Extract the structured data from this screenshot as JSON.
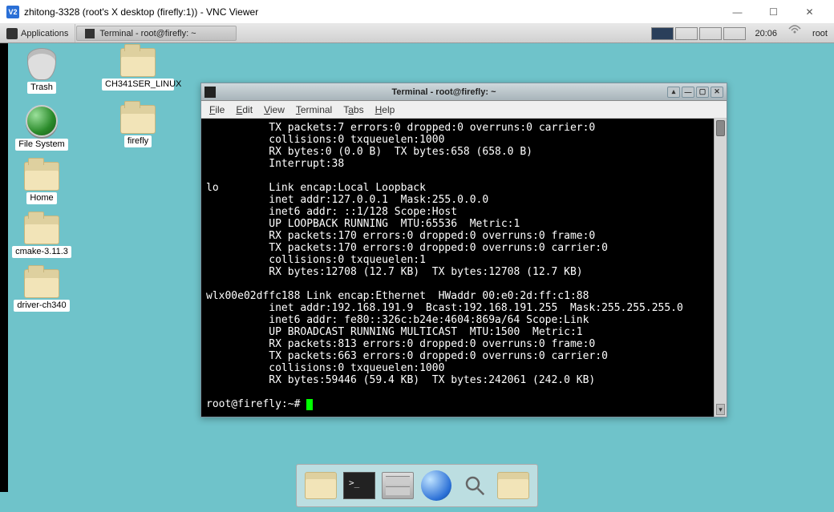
{
  "vnc": {
    "titlebar_icon_label": "V2",
    "title": "zhitong-3328 (root's X desktop (firefly:1)) - VNC Viewer",
    "min_label": "—",
    "max_label": "☐",
    "close_label": "✕"
  },
  "top_panel": {
    "applications": "Applications",
    "task_tab": "Terminal - root@firefly: ~",
    "clock": "20:06",
    "user": "root"
  },
  "desktop_icons": {
    "trash": "Trash",
    "ch341": "CH341SER_LINUX",
    "filesystem": "File System",
    "firefly": "firefly",
    "home": "Home",
    "cmake": "cmake-3.11.3",
    "driver": "driver-ch340"
  },
  "terminal": {
    "title": "Terminal - root@firefly: ~",
    "menus": {
      "file": "File",
      "edit": "Edit",
      "view": "View",
      "terminal": "Terminal",
      "tabs": "Tabs",
      "help": "Help"
    },
    "buttons": {
      "scroll_up": "▴",
      "min": "—",
      "max": "▢",
      "close": "✕"
    },
    "output_lines": [
      "          TX packets:7 errors:0 dropped:0 overruns:0 carrier:0",
      "          collisions:0 txqueuelen:1000",
      "          RX bytes:0 (0.0 B)  TX bytes:658 (658.0 B)",
      "          Interrupt:38",
      "",
      "lo        Link encap:Local Loopback",
      "          inet addr:127.0.0.1  Mask:255.0.0.0",
      "          inet6 addr: ::1/128 Scope:Host",
      "          UP LOOPBACK RUNNING  MTU:65536  Metric:1",
      "          RX packets:170 errors:0 dropped:0 overruns:0 frame:0",
      "          TX packets:170 errors:0 dropped:0 overruns:0 carrier:0",
      "          collisions:0 txqueuelen:1",
      "          RX bytes:12708 (12.7 KB)  TX bytes:12708 (12.7 KB)",
      "",
      "wlx00e02dffc188 Link encap:Ethernet  HWaddr 00:e0:2d:ff:c1:88",
      "          inet addr:192.168.191.9  Bcast:192.168.191.255  Mask:255.255.255.0",
      "          inet6 addr: fe80::326c:b24e:4604:869a/64 Scope:Link",
      "          UP BROADCAST RUNNING MULTICAST  MTU:1500  Metric:1",
      "          RX packets:813 errors:0 dropped:0 overruns:0 frame:0",
      "          TX packets:663 errors:0 dropped:0 overruns:0 carrier:0",
      "          collisions:0 txqueuelen:1000",
      "          RX bytes:59446 (59.4 KB)  TX bytes:242061 (242.0 KB)",
      ""
    ],
    "prompt": "root@firefly:~# "
  },
  "scrollbar": {
    "down_label": "▾"
  }
}
